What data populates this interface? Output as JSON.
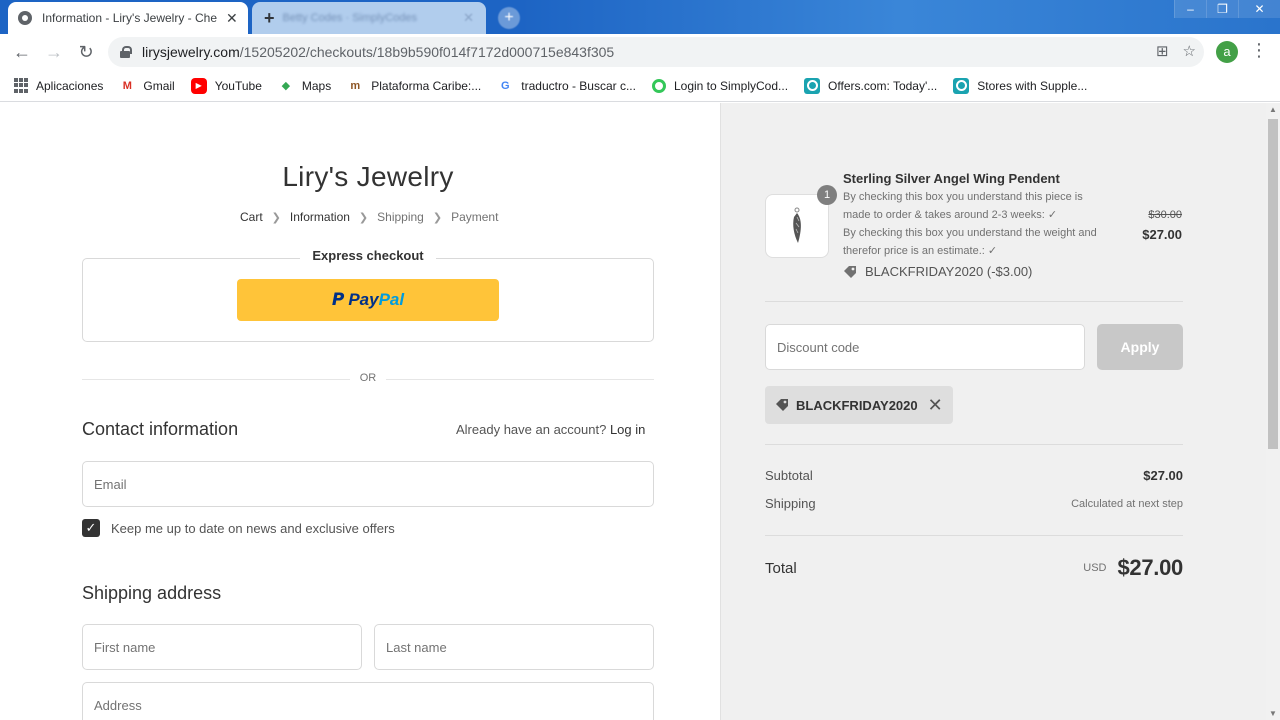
{
  "browser": {
    "active_tab_title": "Information - Liry's Jewelry - Che",
    "inactive_tab_title": "Betty Codes · SimplyCodes",
    "url_domain": "lirysjewelry.com",
    "url_path": "/15205202/checkouts/18b9b590f014f7172d000715e843f305",
    "profile_initial": "a",
    "bookmarks": [
      {
        "label": "Aplicaciones",
        "icon": "apps-icon"
      },
      {
        "label": "Gmail",
        "icon": "gmail-icon"
      },
      {
        "label": "YouTube",
        "icon": "youtube-icon"
      },
      {
        "label": "Maps",
        "icon": "maps-icon"
      },
      {
        "label": "Plataforma Caribe:...",
        "icon": "plataforma-icon"
      },
      {
        "label": "traductro - Buscar c...",
        "icon": "google-icon"
      },
      {
        "label": "Login to SimplyCod...",
        "icon": "simplycodes-icon"
      },
      {
        "label": "Offers.com: Today'...",
        "icon": "offers-icon"
      },
      {
        "label": "Stores with Supple...",
        "icon": "offers-icon"
      }
    ]
  },
  "checkout": {
    "shop_name": "Liry's Jewelry",
    "breadcrumb": [
      "Cart",
      "Information",
      "Shipping",
      "Payment"
    ],
    "express_title": "Express checkout",
    "paypal_label_1": "Pay",
    "paypal_label_2": "Pal",
    "or_label": "OR",
    "contact_title": "Contact information",
    "account_prompt": "Already have an account?",
    "login_label": "Log in",
    "email_placeholder": "Email",
    "newsletter_label": "Keep me up to date on news and exclusive offers",
    "newsletter_checked": true,
    "shipping_title": "Shipping address",
    "first_name_placeholder": "First name",
    "last_name_placeholder": "Last name",
    "address_placeholder": "Address"
  },
  "summary": {
    "product_name": "Sterling Silver Angel Wing Pendent",
    "quantity": "1",
    "option_1": "By checking this box you understand this piece is made to order & takes around 2-3 weeks: ✓",
    "option_2": "By checking this box you understand the weight and therefor price is an estimate.: ✓",
    "product_discount": "BLACKFRIDAY2020 (-$3.00)",
    "price_original": "$30.00",
    "price_now": "$27.00",
    "discount_placeholder": "Discount code",
    "apply_label": "Apply",
    "applied_code": "BLACKFRIDAY2020",
    "subtotal_label": "Subtotal",
    "subtotal_value": "$27.00",
    "shipping_label": "Shipping",
    "shipping_value": "Calculated at next step",
    "total_label": "Total",
    "currency": "USD",
    "total_value": "$27.00"
  },
  "colors": {
    "paypal_yellow": "#ffc439",
    "paypal_dark_blue": "#003087",
    "paypal_light_blue": "#009cde",
    "sidebar_bg": "#f0f0f0",
    "titlebar_blue": "#1d64c4"
  }
}
